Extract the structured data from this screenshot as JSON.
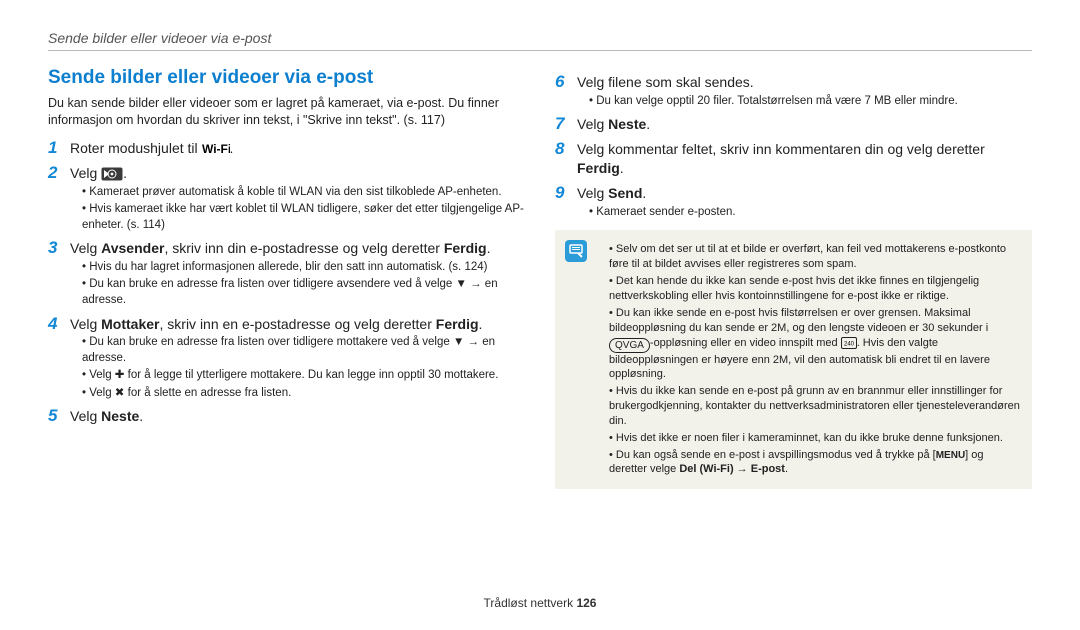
{
  "running_header": "Sende bilder eller videoer via e-post",
  "heading": "Sende bilder eller videoer via e-post",
  "intro": "Du kan sende bilder eller videoer som er lagret på kameraet, via e-post. Du finner informasjon om hvordan du skriver inn tekst, i \"Skrive inn tekst\". (s. 117)",
  "step1_pre": "Roter modushjulet til ",
  "step1_icon_label": "Wi-Fi",
  "step1_post": ".",
  "step2_pre": "Velg ",
  "step2_post": ".",
  "step2_sub_a": "Kameraet prøver automatisk å koble til WLAN via den sist tilkoblede AP-enheten.",
  "step2_sub_b": "Hvis kameraet ikke har vært koblet til WLAN tidligere, søker det etter tilgjengelige AP-enheter. (s. 114)",
  "step3_a": "Velg ",
  "step3_b": "Avsender",
  "step3_c": ", skriv inn din e-postadresse og velg deretter ",
  "step3_d": "Ferdig",
  "step3_e": ".",
  "step3_sub_a": "Hvis du har lagret informasjonen allerede, blir den satt inn automatisk. (s. 124)",
  "step3_sub_b": "Du kan bruke en adresse fra listen over tidligere avsendere ved å velge ▼ → en adresse.",
  "step4_a": "Velg ",
  "step4_b": "Mottaker",
  "step4_c": ", skriv inn en e-postadresse og velg deretter ",
  "step4_d": "Ferdig",
  "step4_e": ".",
  "step4_sub_a": "Du kan bruke en adresse fra listen over tidligere mottakere ved å velge ▼ → en adresse.",
  "step4_sub_b": "Velg ✚ for å legge til ytterligere mottakere. Du kan legge inn opptil 30 mottakere.",
  "step4_sub_c": "Velg ✖ for å slette en adresse fra listen.",
  "step5_a": "Velg ",
  "step5_b": "Neste",
  "step5_c": ".",
  "step6": "Velg filene som skal sendes.",
  "step6_sub_a": "Du kan velge opptil 20 filer. Totalstørrelsen må være 7 MB eller mindre.",
  "step7_a": "Velg ",
  "step7_b": "Neste",
  "step7_c": ".",
  "step8_a": "Velg kommentar feltet, skriv inn kommentaren din og velg deretter ",
  "step8_b": "Ferdig",
  "step8_c": ".",
  "step9_a": "Velg ",
  "step9_b": "Send",
  "step9_c": ".",
  "step9_sub_a": "Kameraet sender e-posten.",
  "note_a": "Selv om det ser ut til at et bilde er overført, kan feil ved mottakerens e-postkonto føre til at bildet avvises eller registreres som spam.",
  "note_b": "Det kan hende du ikke kan sende e-post hvis det ikke finnes en tilgjengelig nettverkskobling eller hvis kontoinnstillingene for e-post ikke er riktige.",
  "note_c_1": "Du kan ikke sende en e-post hvis filstørrelsen er over grensen. Maksimal bildeoppløsning du kan sende er 2M, og den lengste videoen er 30 sekunder i ",
  "note_c_res": "QVGA",
  "note_c_2": "-oppløsning eller en video innspilt med ",
  "note_c_3": ". Hvis den valgte bildeoppløsningen er høyere enn 2M, vil den automatisk bli endret til en lavere oppløsning.",
  "note_d": "Hvis du ikke kan sende en e-post på grunn av en brannmur eller innstillinger for brukergodkjenning, kontakter du nettverksadministratoren eller tjenesteleverandøren din.",
  "note_e": "Hvis det ikke er noen filer i kameraminnet, kan du ikke bruke denne funksjonen.",
  "note_f_1": "Du kan også sende en e-post i avspillingsmodus ved å trykke på ",
  "note_f_menu": "MENU",
  "note_f_2": " og deretter velge ",
  "note_f_3": "Del (Wi-Fi)",
  "note_f_4": " → ",
  "note_f_5": "E-post",
  "note_f_6": ".",
  "footer_section": "Trådløst nettverk  ",
  "footer_page": "126"
}
